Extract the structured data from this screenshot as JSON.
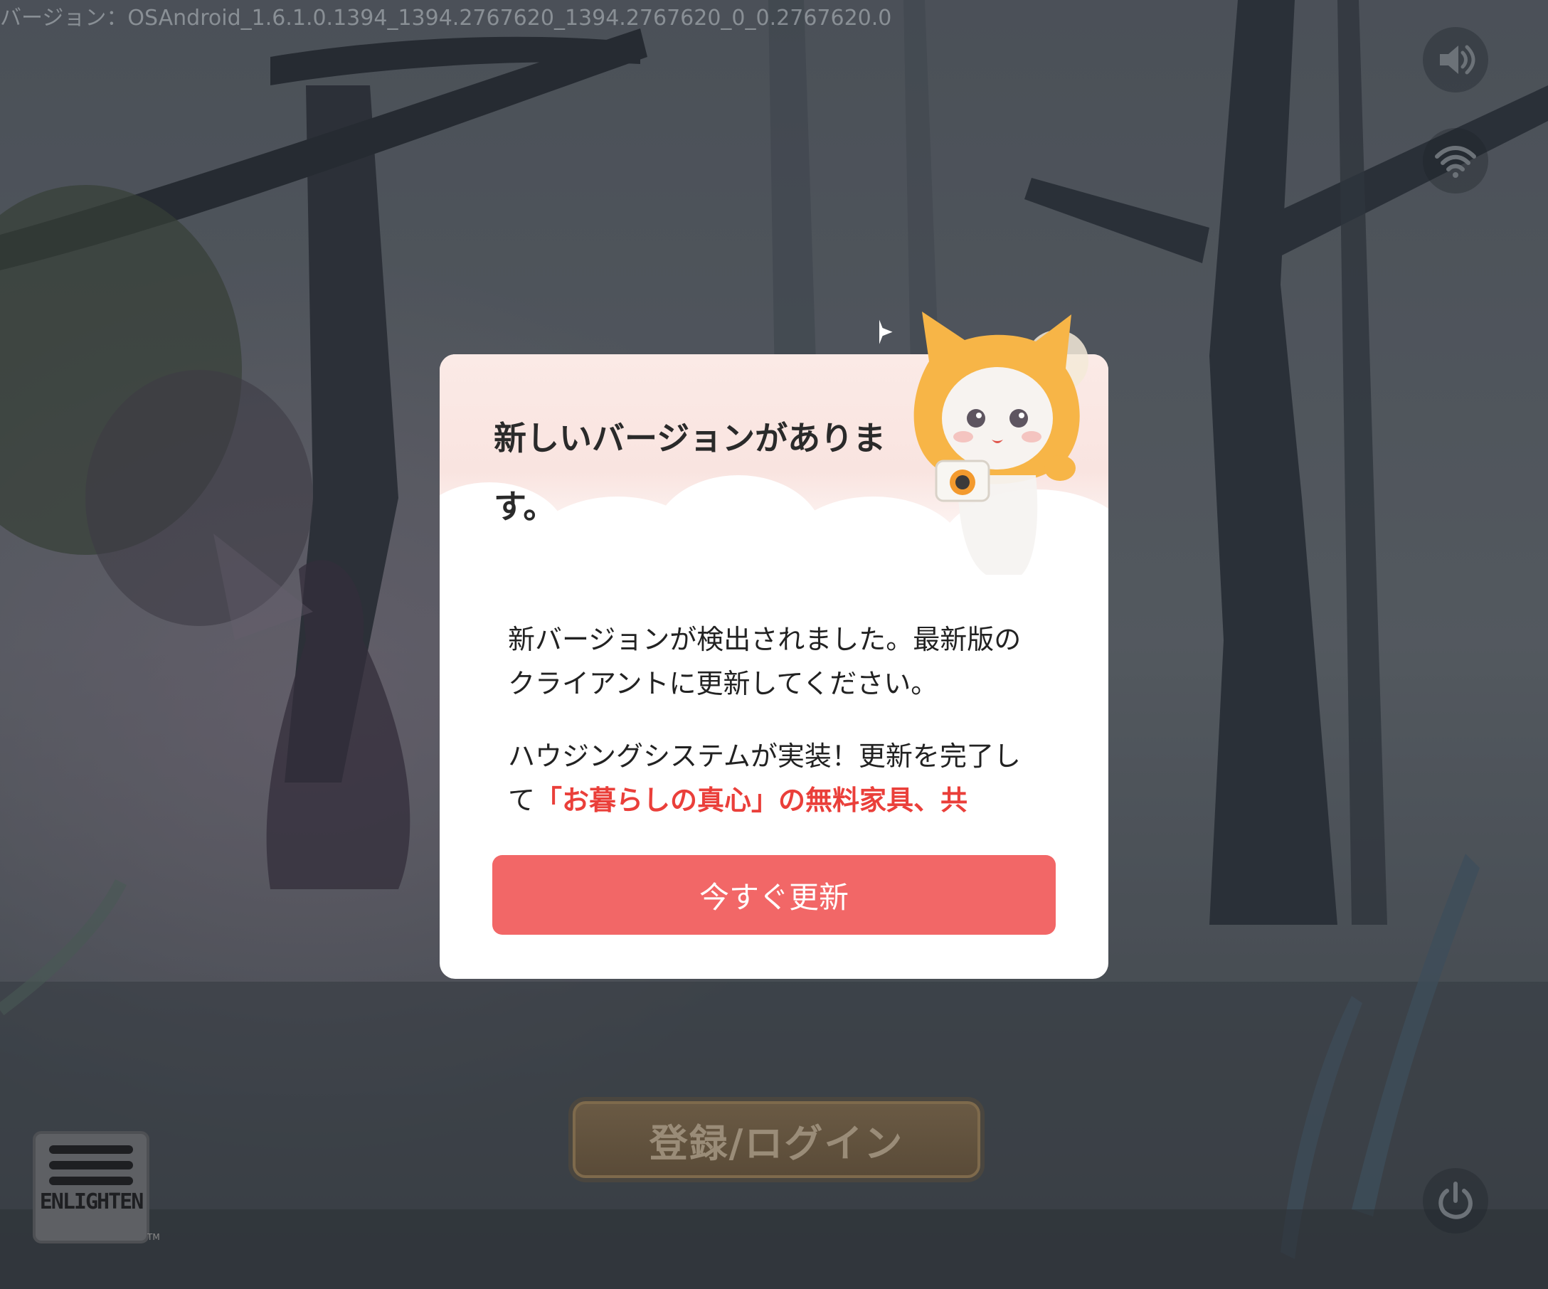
{
  "version_label": "バージョン：",
  "version_text": "OSAndroid_1.6.1.0.1394_1394.2767620_1394.2767620_0_0.2767620.0",
  "icons": {
    "sound": "speaker-icon",
    "network": "wifi-icon",
    "power": "power-icon"
  },
  "login_button": "登録/ログイン",
  "logo": {
    "word": "ENLIGHTEN",
    "tm": "TM"
  },
  "dialog": {
    "title": "新しいバージョンがあります。",
    "message1": "新バージョンが検出されました。最新版のクライアントに更新してください。",
    "message2_prefix": "ハウジングシステムが実装！更新を完了して",
    "message2_highlight": "「お暮らしの真心」の無料家具、共",
    "update_button": "今すぐ更新"
  },
  "colors": {
    "accent": "#f26767",
    "highlight": "#ea3f3a",
    "dialog_bg": "#ffffff"
  }
}
